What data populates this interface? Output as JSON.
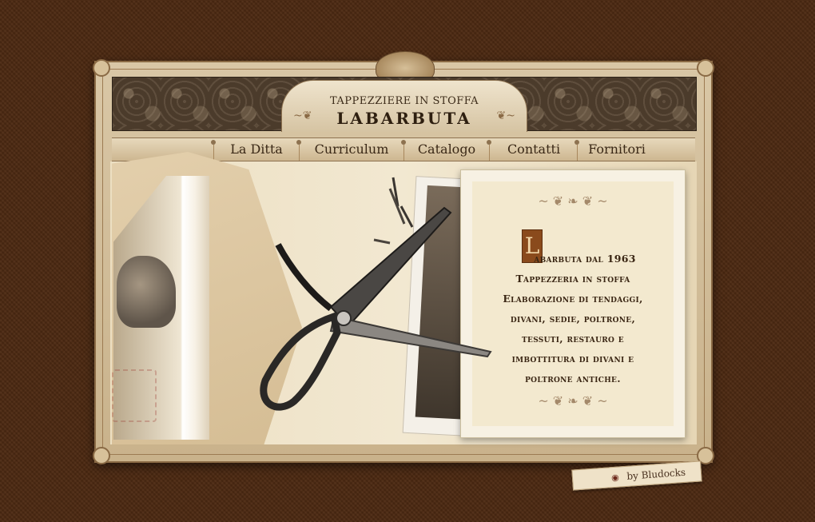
{
  "header": {
    "subtitle": "TAPPEZZIERE IN STOFFA",
    "title": "LABARBUTA"
  },
  "nav": {
    "items": [
      {
        "label": "La Ditta"
      },
      {
        "label": "Curriculum"
      },
      {
        "label": "Catalogo"
      },
      {
        "label": "Contatti"
      },
      {
        "label": "Fornitori"
      }
    ]
  },
  "content": {
    "dropcap": "L",
    "lines": [
      "abarbuta dal 1963",
      "Tappezzeria in stoffa",
      "Elaborazione di tendaggi,",
      "divani, sedie, poltrone,",
      "tessuti, restauro e",
      "imbottitura di divani e",
      "poltrone antiche."
    ]
  },
  "credit": {
    "label": "by Bludocks",
    "icon": "eye-icon"
  },
  "colors": {
    "background": "#4e2a12",
    "dropcap": "#8a4a1c",
    "text": "#3a2614"
  }
}
